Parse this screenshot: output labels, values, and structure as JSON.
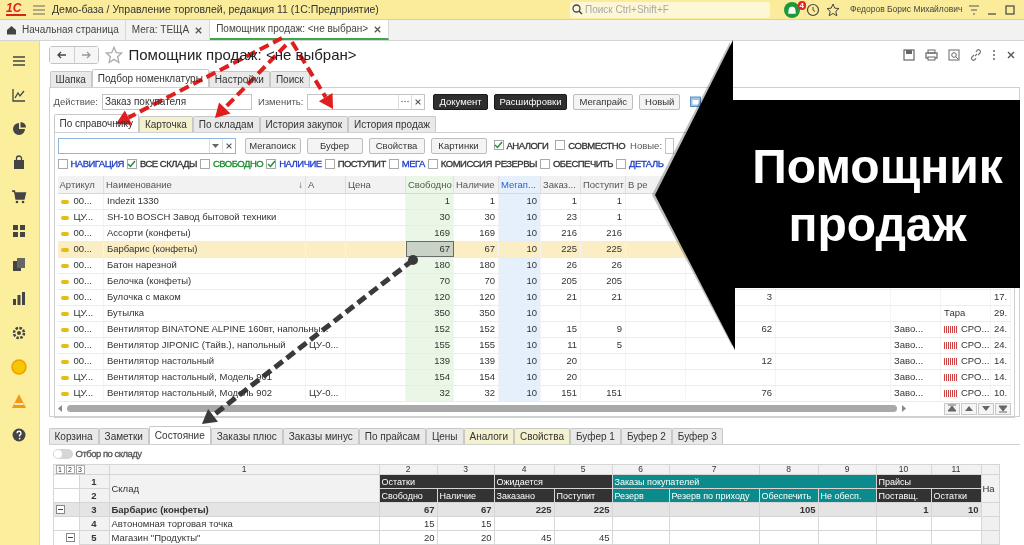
{
  "app_bar": {
    "logo": "1С",
    "title": "Демо-база / Управление торговлей, редакция 11  (1С:Предприятие)",
    "search": {
      "placeholder": "Поиск Ctrl+Shift+F"
    },
    "notifications": "4",
    "user": "Федоров Борис Михайлович"
  },
  "open_tabs": [
    {
      "label": "Начальная страница",
      "selected": false,
      "kind": "home"
    },
    {
      "label": "Мега: ТЕЩА",
      "selected": false,
      "kind": "doc"
    },
    {
      "label": "Помощник продаж: <не выбран>",
      "selected": true,
      "kind": "doc"
    }
  ],
  "form": {
    "title": "Помощник продаж: <не выбран>",
    "tabs": [
      {
        "label": "Шапка",
        "selected": false
      },
      {
        "label": "Подбор номенклатуры",
        "selected": true
      },
      {
        "label": "Настройки",
        "selected": false
      },
      {
        "label": "Поиск",
        "selected": false
      }
    ],
    "action": {
      "label": "Действие:",
      "value": "Заказ покупателя"
    },
    "change": {
      "label": "Изменить:"
    },
    "buttons": [
      {
        "label": "Документ",
        "kind": "dark"
      },
      {
        "label": "Расшифровки",
        "kind": "dark"
      },
      {
        "label": "Мегапрайс",
        "kind": "light"
      },
      {
        "label": "Новый",
        "kind": "light"
      }
    ]
  },
  "source_tabs": [
    {
      "label": "По справочнику",
      "selected": true,
      "highlight": false
    },
    {
      "label": "Карточка",
      "selected": false,
      "highlight": true
    },
    {
      "label": "По складам",
      "selected": false,
      "highlight": false
    },
    {
      "label": "История закупок",
      "selected": false,
      "highlight": false
    },
    {
      "label": "История продаж",
      "selected": false,
      "highlight": false
    }
  ],
  "search_row": {
    "buttons": [
      "Мегапоиск",
      "Буфер",
      "Свойства",
      "Картинки"
    ],
    "checks": [
      {
        "label": "АНАЛОГИ",
        "checked": true
      },
      {
        "label": "СОВМЕСТНО",
        "checked": false
      }
    ],
    "new_label": "Новые:"
  },
  "filters": [
    {
      "label": "НАВИГАЦИЯ",
      "kind": "checkbox",
      "checked": false,
      "color": "#1f3fc8"
    },
    {
      "label": "ВСЕ СКЛАДЫ",
      "kind": "checkbox",
      "checked": true,
      "color": "#333333"
    },
    {
      "label": "СВОБОДНО",
      "kind": "checkbox",
      "checked": false,
      "color": "#1a8a2a"
    },
    {
      "label": "НАЛИЧИЕ",
      "kind": "checkbox",
      "checked": true,
      "color": "#1f3fc8"
    },
    {
      "label": "ПОСТУПИТ",
      "kind": "checkbox",
      "checked": false,
      "color": "#333333"
    },
    {
      "label": "МЕГА",
      "kind": "checkbox",
      "checked": false,
      "color": "#1f3fc8"
    },
    {
      "label": "КОМИССИЯ",
      "kind": "checkbox",
      "checked": false,
      "color": "#333333"
    },
    {
      "label": "РЕЗЕРВЫ",
      "kind": "label",
      "color": "#333333"
    },
    {
      "label": "ОБЕСПЕЧИТЬ",
      "kind": "checkbox",
      "checked": false,
      "color": "#333333"
    },
    {
      "label": "ДЕТАЛЬ",
      "kind": "checkbox",
      "checked": false,
      "color": "#1f3fc8"
    }
  ],
  "products": {
    "sort_mark": "↓",
    "columns": [
      {
        "label": "Артикул"
      },
      {
        "label": "Наименование"
      },
      {
        "label": "А"
      },
      {
        "label": "Цена"
      },
      {
        "label": "Свободно",
        "color": "#eaf7e6"
      },
      {
        "label": "Наличие"
      },
      {
        "label": "Мегап...",
        "color": "#e5f0fc"
      },
      {
        "label": "Заказ..."
      },
      {
        "label": "Поступит"
      },
      {
        "label": "В ре"
      }
    ],
    "rows": [
      {
        "selected": false,
        "code": "00...",
        "name": "Indezit 1330",
        "free": "1",
        "stock": "1",
        "mega": "10",
        "ordered": "1",
        "incoming": "1"
      },
      {
        "selected": false,
        "code": "ЦУ...",
        "name": "SH-10 BOSCH Завод бытовой техники",
        "free": "30",
        "stock": "30",
        "mega": "10",
        "ordered": "23",
        "incoming": "1"
      },
      {
        "selected": false,
        "code": "00...",
        "name": "Ассорти (конфеты)",
        "free": "169",
        "stock": "169",
        "mega": "10",
        "ordered": "216",
        "incoming": "216"
      },
      {
        "selected": true,
        "code": "00...",
        "name": "Барбарис (конфеты)",
        "free": "67",
        "stock": "67",
        "mega": "10",
        "ordered": "225",
        "incoming": "225"
      },
      {
        "selected": false,
        "code": "00...",
        "name": "Батон нарезной",
        "free": "180",
        "stock": "180",
        "mega": "10",
        "ordered": "26",
        "incoming": "26"
      },
      {
        "selected": false,
        "code": "00...",
        "name": "Белочка (конфеты)",
        "free": "70",
        "stock": "70",
        "mega": "10",
        "ordered": "205",
        "incoming": "205"
      },
      {
        "selected": false,
        "code": "00...",
        "name": "Булочка с маком",
        "free": "120",
        "stock": "120",
        "mega": "10",
        "ordered": "21",
        "incoming": "21",
        "column_11": "3",
        "column_15": "17."
      },
      {
        "selected": false,
        "code": "ЦУ...",
        "name": "Бутылка",
        "free": "350",
        "stock": "350",
        "mega": "10",
        "column_14": {
          "text": "Тара",
          "swatch": false
        },
        "column_15": "29."
      },
      {
        "selected": false,
        "code": "00...",
        "name": "Вентилятор BINATONE ALPINE 160вт, напольны...",
        "free": "152",
        "stock": "152",
        "mega": "10",
        "ordered": "15",
        "incoming": "9",
        "column_11": "62",
        "column_13": "Заво...",
        "column_14": {
          "text": "СРО...",
          "swatch": true
        },
        "column_15": "24."
      },
      {
        "selected": false,
        "code": "00...",
        "name": "Вентилятор JIPONIC (Тайв.), напольный",
        "a": "ЦУ-0...",
        "free": "155",
        "stock": "155",
        "mega": "10",
        "ordered": "11",
        "incoming": "5",
        "column_13": "Заво...",
        "column_14": {
          "text": "СРО...",
          "swatch": true
        },
        "column_15": "24."
      },
      {
        "selected": false,
        "code": "00...",
        "name": "Вентилятор настольный",
        "free": "139",
        "stock": "139",
        "mega": "10",
        "ordered": "20",
        "column_11": "12",
        "column_13": "Заво...",
        "column_14": {
          "text": "СРО...",
          "swatch": true
        },
        "column_15": "14."
      },
      {
        "selected": false,
        "code": "ЦУ...",
        "name": "Вентилятор настольный, Модель 901",
        "free": "154",
        "stock": "154",
        "mega": "10",
        "ordered": "20",
        "column_13": "Заво...",
        "column_14": {
          "text": "СРО...",
          "swatch": true
        },
        "column_15": "14."
      },
      {
        "selected": false,
        "code": "ЦУ...",
        "name": "Вентилятор настольный, Модель 902",
        "a": "ЦУ-0...",
        "free": "32",
        "stock": "32",
        "mega": "10",
        "ordered": "151",
        "incoming": "151",
        "column_11": "76",
        "column_13": "Заво...",
        "column_14": {
          "text": "СРО...",
          "swatch": true
        },
        "column_15": "10."
      }
    ]
  },
  "bottom_tabs": [
    {
      "label": "Корзина",
      "selected": false,
      "highlight": false
    },
    {
      "label": "Заметки",
      "selected": false,
      "highlight": false
    },
    {
      "label": "Состояние",
      "selected": true,
      "highlight": false
    },
    {
      "label": "Заказы плюс",
      "selected": false,
      "highlight": false
    },
    {
      "label": "Заказы минус",
      "selected": false,
      "highlight": false
    },
    {
      "label": "По прайсам",
      "selected": false,
      "highlight": false
    },
    {
      "label": "Цены",
      "selected": false,
      "highlight": false
    },
    {
      "label": "Аналоги",
      "selected": false,
      "highlight": true
    },
    {
      "label": "Свойства",
      "selected": false,
      "highlight": true
    },
    {
      "label": "Буфер 1",
      "selected": false,
      "highlight": false
    },
    {
      "label": "Буфер 2",
      "selected": false,
      "highlight": false
    },
    {
      "label": "Буфер 3",
      "selected": false,
      "highlight": false
    }
  ],
  "stock_filter": {
    "label": "Отбор по складу",
    "on": false
  },
  "stock_grid": {
    "levels": [
      "1",
      "2",
      "3"
    ],
    "column_numbers": [
      "1",
      "2",
      "3",
      "4",
      "5",
      "6",
      "7",
      "8",
      "9",
      "10",
      "11"
    ],
    "header_row_numbers": [
      "1",
      "2"
    ],
    "name_header": "Склад",
    "groups": [
      {
        "label": "Остатки",
        "color": "#333333",
        "columns": [
          "Свободно",
          "Наличие"
        ]
      },
      {
        "label": "Ожидается",
        "color": "#333333",
        "columns": [
          "Заказано",
          "Поступит"
        ]
      },
      {
        "label": "Заказы покупателей",
        "color": "#0b8b8b",
        "columns": [
          "Резерв",
          "Резерв по приходу",
          "Обеспечить",
          "Не обесп."
        ]
      },
      {
        "label": "Прайсы",
        "color": "#333333",
        "columns": [
          "Поставщ.",
          "Остатки"
        ]
      }
    ],
    "cut_header": "На",
    "rows": [
      {
        "number": "3",
        "name": "Барбарис (конфеты)",
        "kind": "group",
        "expanded": true,
        "bold": true,
        "values": {
          "free": "67",
          "stock": "67",
          "ordered": "225",
          "incoming": "225",
          "to_provide": "105",
          "supplier": "1",
          "price_stock": "10"
        }
      },
      {
        "number": "4",
        "name": "Автономная торговая точка",
        "kind": "leaf",
        "bold": false,
        "values": {
          "free": "15",
          "stock": "15"
        }
      },
      {
        "number": "5",
        "name": "Магазин \"Продукты\"",
        "kind": "group",
        "expanded": true,
        "bold": false,
        "values": {
          "free": "20",
          "stock": "20",
          "ordered": "45",
          "incoming": "45"
        }
      }
    ]
  },
  "callout": {
    "text": "Помощник продаж"
  }
}
